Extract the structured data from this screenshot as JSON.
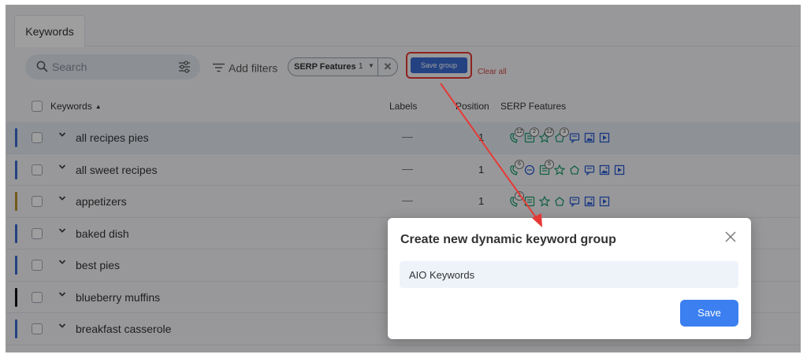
{
  "tabs": [
    {
      "label": "Keywords"
    }
  ],
  "toolbar": {
    "search_placeholder": "Search",
    "add_filters_label": "Add filters",
    "filter_chip": {
      "label": "SERP Features",
      "count": "1"
    },
    "save_group_label": "Save group",
    "clear_all_label": "Clear all"
  },
  "table": {
    "columns": {
      "keywords": "Keywords",
      "labels": "Labels",
      "position": "Position",
      "serp_features": "SERP Features"
    },
    "rows": [
      {
        "keyword": "all recipes pies",
        "labels": "—",
        "position": "1",
        "bar_color": "#3a6bd0",
        "icons": [
          {
            "name": "local-pack-icon",
            "badge": "12"
          },
          {
            "name": "featured-snippet-icon",
            "badge": "2"
          },
          {
            "name": "reviews-icon",
            "badge": "12"
          },
          {
            "name": "knowledge-panel-icon",
            "badge": "3"
          },
          {
            "name": "people-also-ask-icon"
          },
          {
            "name": "images-icon"
          },
          {
            "name": "video-icon"
          }
        ]
      },
      {
        "keyword": "all sweet recipes",
        "labels": "—",
        "position": "1",
        "bar_color": "#3a6bd0",
        "icons": [
          {
            "name": "local-pack-icon",
            "badge": "6"
          },
          {
            "name": "ai-overview-icon"
          },
          {
            "name": "featured-snippet-icon",
            "badge": "5"
          },
          {
            "name": "reviews-icon"
          },
          {
            "name": "knowledge-panel-icon"
          },
          {
            "name": "people-also-ask-icon"
          },
          {
            "name": "images-icon"
          },
          {
            "name": "video-icon"
          }
        ]
      },
      {
        "keyword": "appetizers",
        "labels": "—",
        "position": "1",
        "bar_color": "#b8932d",
        "icons": [
          {
            "name": "local-pack-icon",
            "badge": "2"
          },
          {
            "name": "featured-snippet-icon"
          },
          {
            "name": "reviews-icon"
          },
          {
            "name": "knowledge-panel-icon"
          },
          {
            "name": "people-also-ask-icon"
          },
          {
            "name": "images-icon"
          },
          {
            "name": "video-icon"
          }
        ]
      },
      {
        "keyword": "baked dish",
        "labels": "",
        "position": "",
        "bar_color": "#3a6bd0",
        "icons": []
      },
      {
        "keyword": "best pies",
        "labels": "",
        "position": "",
        "bar_color": "#3a6bd0",
        "icons": []
      },
      {
        "keyword": "blueberry muffins",
        "labels": "",
        "position": "",
        "bar_color": "#111111",
        "icons": []
      },
      {
        "keyword": "breakfast casserole",
        "labels": "",
        "position": "",
        "bar_color": "#3a6bd0",
        "icons": []
      }
    ]
  },
  "modal": {
    "title": "Create new dynamic keyword group",
    "input_value": "AIO Keywords",
    "save_label": "Save"
  },
  "colors": {
    "accent": "#3b7ff0",
    "serp_icon": "#1f9d6b",
    "highlight": "#e53935"
  }
}
